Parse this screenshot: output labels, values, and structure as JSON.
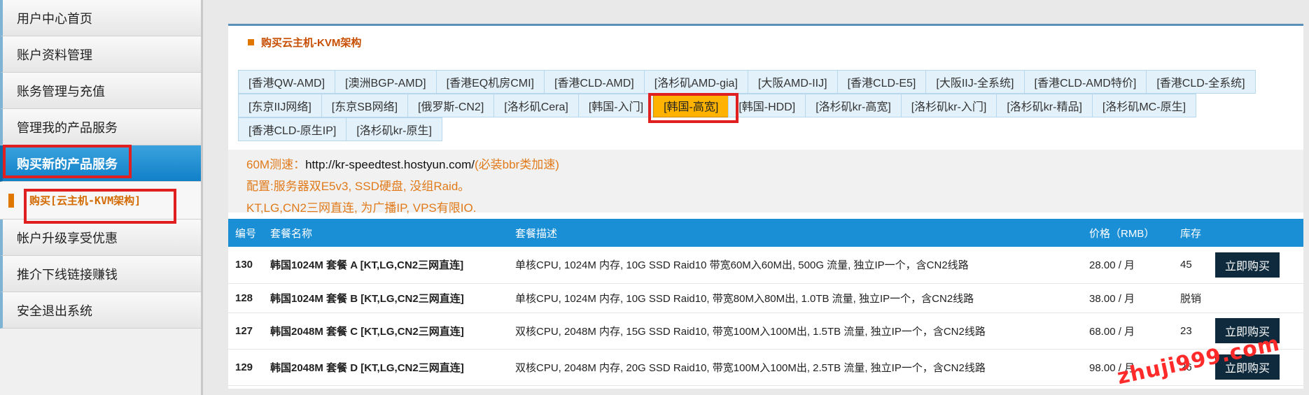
{
  "sidebar": {
    "items": [
      {
        "label": "用户中心首页"
      },
      {
        "label": "账户资料管理"
      },
      {
        "label": "账务管理与充值"
      },
      {
        "label": "管理我的产品服务"
      },
      {
        "label": "购买新的产品服务"
      }
    ],
    "sub_item": "购买[云主机-KVM架构]",
    "items_after": [
      {
        "label": "帐户升级享受优惠"
      },
      {
        "label": "推介下线链接赚钱"
      },
      {
        "label": "安全退出系统"
      }
    ]
  },
  "panel": {
    "title": "购买云主机-KVM架构"
  },
  "tabs": {
    "row1": [
      "[香港QW-AMD]",
      "[澳洲BGP-AMD]",
      "[香港EQ机房CMI]",
      "[香港CLD-AMD]",
      "[洛杉矶AMD-gia]",
      "[大阪AMD-IIJ]",
      "[香港CLD-E5]",
      "[大阪IIJ-全系统]",
      "[香港CLD-AMD特价]",
      "[香港CLD-全系统]"
    ],
    "row2": [
      "[东京IIJ网络]",
      "[东京SB网络]",
      "[俄罗斯-CN2]",
      "[洛杉矶Cera]",
      "[韩国-入门]",
      "[韩国-高宽]",
      "[韩国-HDD]",
      "[洛杉矶kr-高宽]",
      "[洛杉矶kr-入门]",
      "[洛杉矶kr-精品]",
      "[洛杉矶MC-原生]"
    ],
    "row3": [
      "[香港CLD-原生IP]",
      "[洛杉矶kr-原生]"
    ]
  },
  "info": {
    "speedtest_prefix": "60M测速：",
    "speedtest_url": "http://kr-speedtest.hostyun.com/",
    "speedtest_note": "(必装bbr类加速)",
    "config": "配置:服务器双E5v3, SSD硬盘, 没组Raid。",
    "network": "KT,LG,CN2三网直连, 为广播IP, VPS有限IO."
  },
  "table": {
    "headers": {
      "id": "编号",
      "name": "套餐名称",
      "desc": "套餐描述",
      "price": "价格（RMB）",
      "stock": "库存"
    },
    "rows": [
      {
        "id": "130",
        "name": "韩国1024M 套餐 A [KT,LG,CN2三网直连]",
        "desc": "单核CPU, 1024M 内存, 10G SSD Raid10 带宽60M入60M出, 500G 流量, 独立IP一个，含CN2线路",
        "price": "28.00 / 月",
        "stock": "45",
        "action": "立即购买"
      },
      {
        "id": "128",
        "name": "韩国1024M 套餐 B [KT,LG,CN2三网直连]",
        "desc": "单核CPU, 1024M 内存, 10G SSD Raid10, 带宽80M入80M出, 1.0TB 流量, 独立IP一个，含CN2线路",
        "price": "38.00 / 月",
        "stock": "脱销",
        "action": ""
      },
      {
        "id": "127",
        "name": "韩国2048M 套餐 C [KT,LG,CN2三网直连]",
        "desc": "双核CPU, 2048M 内存, 15G SSD Raid10, 带宽100M入100M出, 1.5TB 流量, 独立IP一个，含CN2线路",
        "price": "68.00 / 月",
        "stock": "23",
        "action": "立即购买"
      },
      {
        "id": "129",
        "name": "韩国2048M 套餐 D [KT,LG,CN2三网直连]",
        "desc": "双核CPU, 2048M 内存, 20G SSD Raid10, 带宽100M入100M出, 2.5TB 流量, 独立IP一个，含CN2线路",
        "price": "98.00 / 月",
        "stock": "26",
        "action": "立即购买"
      }
    ]
  },
  "watermark": "zhuji999.com"
}
